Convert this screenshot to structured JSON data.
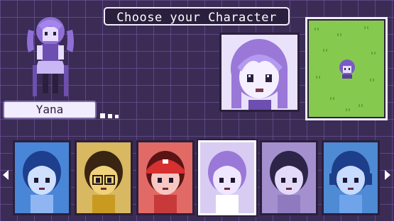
{
  "header": {
    "title": "Choose your Character"
  },
  "selected_character": {
    "name": "Yana"
  },
  "roster": {
    "characters": [
      {
        "bg": "#4a86d8",
        "hair": "#1d3f8e",
        "skin": "#cfe0ff",
        "shirt": "#8fb6f0",
        "accessory": "none"
      },
      {
        "bg": "#d8b860",
        "hair": "#3a2412",
        "skin": "#f0d27a",
        "shirt": "#c89a20",
        "accessory": "glasses"
      },
      {
        "bg": "#e26a66",
        "hair": "#5a1414",
        "skin": "#f7c7c2",
        "shirt": "#c83a3a",
        "accessory": "cap"
      },
      {
        "bg": "#d8ccf2",
        "hair": "#9a78d8",
        "skin": "#efe7ff",
        "shirt": "#ffffff",
        "accessory": "none"
      },
      {
        "bg": "#a590cf",
        "hair": "#2c2548",
        "skin": "#e3dafa",
        "shirt": "#8f7ac0",
        "accessory": "none"
      },
      {
        "bg": "#4f8ad4",
        "hair": "#1d3e8a",
        "skin": "#c6dbff",
        "shirt": "#6fa4ea",
        "accessory": "headphones"
      }
    ],
    "selected_index": 3
  },
  "colors": {
    "background": "#3b2c55",
    "panel": "#2a1f3d",
    "accent": "#f2ecff",
    "grass": "#86c94f"
  },
  "icons": {
    "left": "arrow-left-icon",
    "right": "arrow-right-icon",
    "more": "ellipsis-icon"
  }
}
